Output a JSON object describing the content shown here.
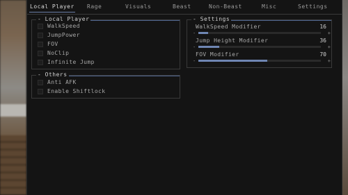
{
  "tabs": [
    {
      "label": "Local Player",
      "active": true
    },
    {
      "label": "Rage",
      "active": false
    },
    {
      "label": "Visuals",
      "active": false
    },
    {
      "label": "Beast",
      "active": false
    },
    {
      "label": "Non-Beast",
      "active": false
    },
    {
      "label": "Misc",
      "active": false
    },
    {
      "label": "Settings",
      "active": false
    }
  ],
  "local_player": {
    "title": "Local Player",
    "items": [
      {
        "label": "WalkSpeed",
        "checked": false
      },
      {
        "label": "JumpPower",
        "checked": false
      },
      {
        "label": "FOV",
        "checked": false
      },
      {
        "label": "NoClip",
        "checked": false
      },
      {
        "label": "Infinite Jump",
        "checked": false
      }
    ]
  },
  "others": {
    "title": "Others",
    "items": [
      {
        "label": "Anti AFK",
        "checked": false
      },
      {
        "label": "Enable Shiftlock",
        "checked": false
      }
    ]
  },
  "settings": {
    "title": "Settings",
    "sliders": [
      {
        "label": "WalkSpeed Modifier",
        "value": "16",
        "fraction": 0.08
      },
      {
        "label": "Jump Height Modifier",
        "value": "36",
        "fraction": 0.17
      },
      {
        "label": "FOV Modifier",
        "value": "70",
        "fraction": 0.56
      }
    ],
    "minus": "-",
    "plus": "+"
  },
  "colors": {
    "accent": "#6f86b3",
    "panel": "#141414",
    "border": "#3a3a3a"
  }
}
